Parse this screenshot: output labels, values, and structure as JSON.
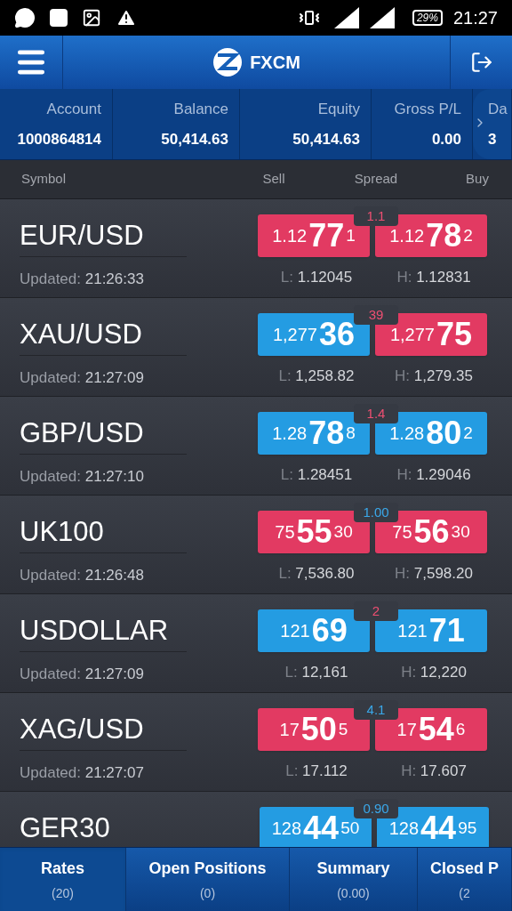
{
  "status_bar": {
    "battery": "29%",
    "time": "21:27"
  },
  "header": {
    "brand": "FXCM"
  },
  "account_summary": [
    {
      "label": "Account",
      "value": "1000864814"
    },
    {
      "label": "Balance",
      "value": "50,414.63"
    },
    {
      "label": "Equity",
      "value": "50,414.63"
    },
    {
      "label": "Gross P/L",
      "value": "0.00"
    },
    {
      "label": "Da",
      "value": "3"
    }
  ],
  "columns": [
    "Symbol",
    "Sell",
    "Spread",
    "Buy"
  ],
  "rates": [
    {
      "symbol": "EUR/USD",
      "updated_label": "Updated:",
      "updated": "21:26:33",
      "spread": {
        "text": "1.1",
        "color": "#ef4f72"
      },
      "sell": {
        "prefix": "1.12",
        "big": "77",
        "suffix": "1",
        "color": "#e23a62"
      },
      "buy": {
        "prefix": "1.12",
        "big": "78",
        "suffix": "2",
        "color": "#e23a62"
      },
      "low_label": "L:",
      "low": "1.12045",
      "high_label": "H:",
      "high": "1.12831"
    },
    {
      "symbol": "XAU/USD",
      "updated_label": "Updated:",
      "updated": "21:27:09",
      "spread": {
        "text": "39",
        "color": "#ef4f72"
      },
      "sell": {
        "prefix": "1,277",
        "big": "36",
        "color": "#249ce2"
      },
      "buy": {
        "prefix": "1,277",
        "big": "75",
        "color": "#e23a62"
      },
      "low_label": "L:",
      "low": "1,258.82",
      "high_label": "H:",
      "high": "1,279.35"
    },
    {
      "symbol": "GBP/USD",
      "updated_label": "Updated:",
      "updated": "21:27:10",
      "spread": {
        "text": "1.4",
        "color": "#ef4f72"
      },
      "sell": {
        "prefix": "1.28",
        "big": "78",
        "suffix": "8",
        "color": "#249ce2"
      },
      "buy": {
        "prefix": "1.28",
        "big": "80",
        "suffix": "2",
        "color": "#249ce2"
      },
      "low_label": "L:",
      "low": "1.28451",
      "high_label": "H:",
      "high": "1.29046"
    },
    {
      "symbol": "UK100",
      "updated_label": "Updated:",
      "updated": "21:26:48",
      "spread": {
        "text": "1.00",
        "color": "#3aa8ea"
      },
      "sell": {
        "prefix": "75",
        "big": "55",
        "suffix": "30",
        "color": "#e23a62"
      },
      "buy": {
        "prefix": "75",
        "big": "56",
        "suffix": "30",
        "color": "#e23a62"
      },
      "low_label": "L:",
      "low": "7,536.80",
      "high_label": "H:",
      "high": "7,598.20"
    },
    {
      "symbol": "USDOLLAR",
      "updated_label": "Updated:",
      "updated": "21:27:09",
      "spread": {
        "text": "2",
        "color": "#ef4f72"
      },
      "sell": {
        "prefix": "121",
        "big": "69",
        "color": "#249ce2"
      },
      "buy": {
        "prefix": "121",
        "big": "71",
        "color": "#249ce2"
      },
      "low_label": "L:",
      "low": "12,161",
      "high_label": "H:",
      "high": "12,220"
    },
    {
      "symbol": "XAG/USD",
      "updated_label": "Updated:",
      "updated": "21:27:07",
      "spread": {
        "text": "4.1",
        "color": "#3aa8ea"
      },
      "sell": {
        "prefix": "17",
        "big": "50",
        "suffix": "5",
        "color": "#e23a62"
      },
      "buy": {
        "prefix": "17",
        "big": "54",
        "suffix": "6",
        "color": "#e23a62"
      },
      "low_label": "L:",
      "low": "17.112",
      "high_label": "H:",
      "high": "17.607"
    },
    {
      "symbol": "GER30",
      "spread": {
        "text": "0.90",
        "color": "#3aa8ea"
      },
      "sell": {
        "prefix": "128",
        "big": "44",
        "suffix": "50",
        "color": "#249ce2"
      },
      "buy": {
        "prefix": "128",
        "big": "44",
        "suffix": "95",
        "color": "#249ce2"
      }
    }
  ],
  "tabs": [
    {
      "label": "Rates",
      "count": "(20)",
      "selected": true
    },
    {
      "label": "Open Positions",
      "count": "(0)",
      "selected": false
    },
    {
      "label": "Summary",
      "count": "(0.00)",
      "selected": false
    },
    {
      "label": "Closed P",
      "count": "(2",
      "selected": false
    }
  ]
}
